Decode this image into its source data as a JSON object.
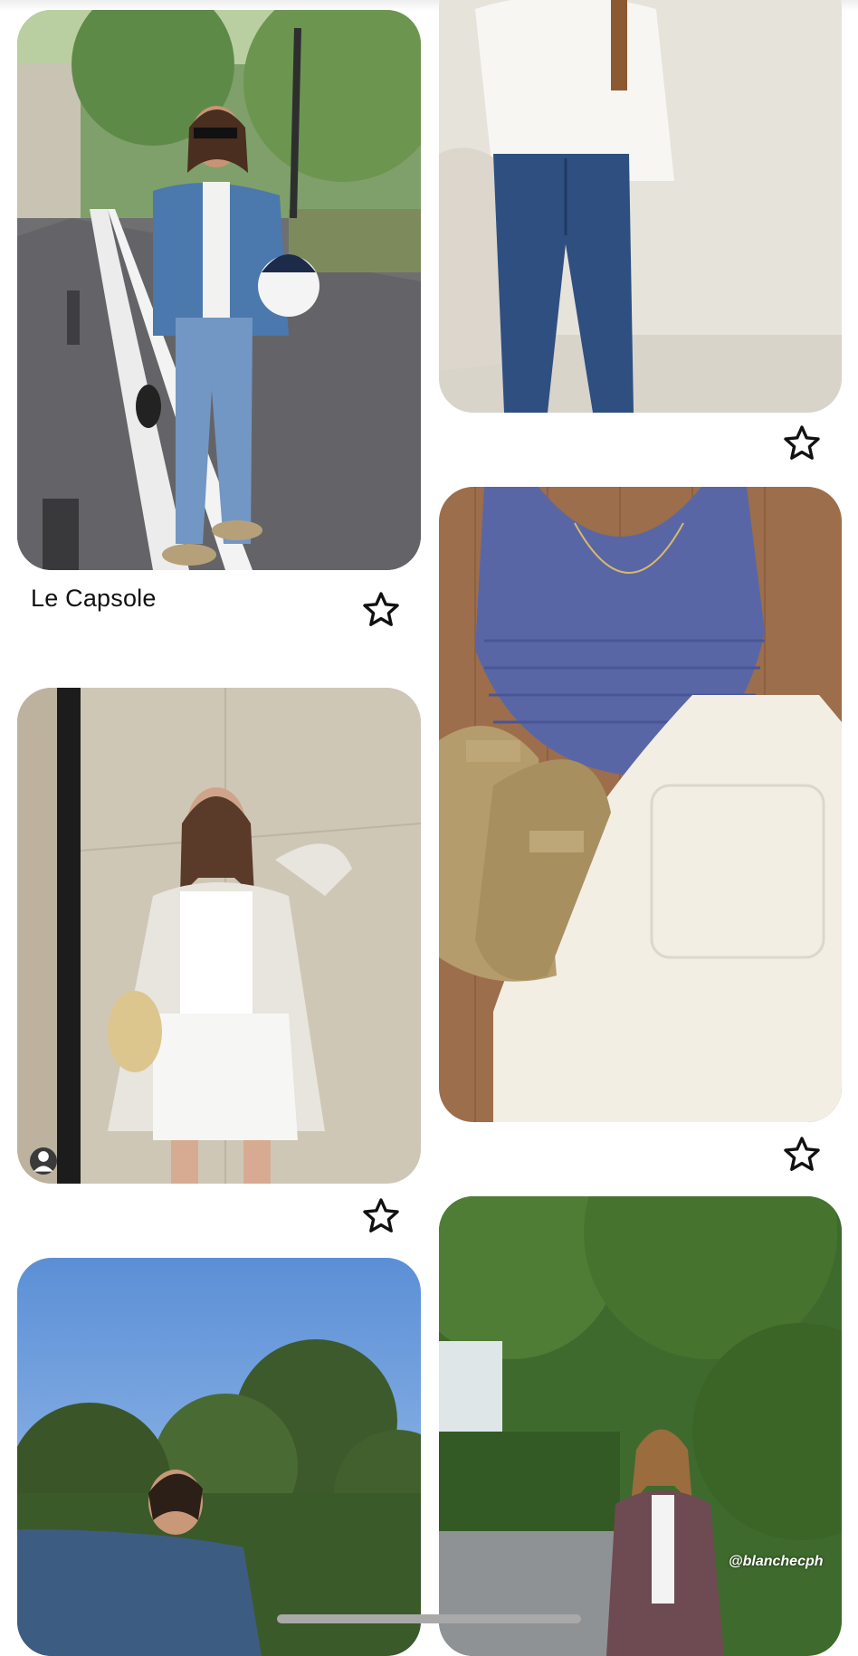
{
  "feed": {
    "pins": [
      {
        "id": "pin-street-denim",
        "title": "Le Capsole",
        "saved": false,
        "icon": "star-outline-icon"
      },
      {
        "id": "pin-white-sweater-jeans",
        "title": "",
        "saved": false,
        "icon": "star-outline-icon"
      },
      {
        "id": "pin-cardigan-shorts",
        "title": "",
        "saved": false,
        "icon": "star-outline-icon"
      },
      {
        "id": "pin-flatlay-tank-birkenstocks",
        "title": "",
        "saved": false,
        "icon": "star-outline-icon"
      },
      {
        "id": "pin-sky-trees",
        "title": "",
        "saved": false
      },
      {
        "id": "pin-blazer-garden",
        "title": "",
        "watermark": "@blanchecph",
        "saved": false
      }
    ]
  },
  "colors": {
    "background": "#ffffff",
    "star_stroke": "#111111",
    "home_indicator": "#a9a9a9"
  }
}
